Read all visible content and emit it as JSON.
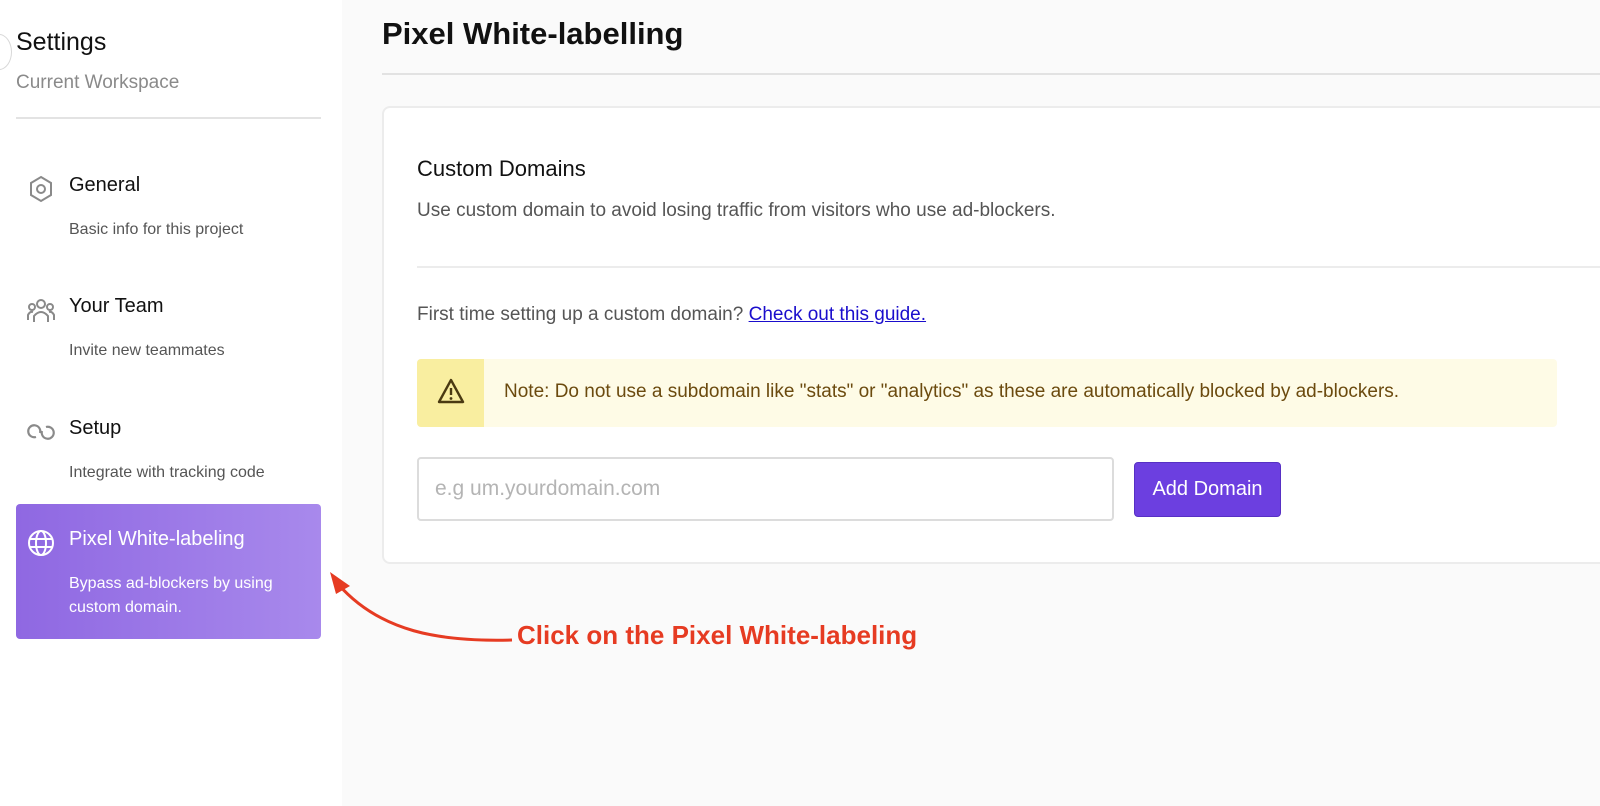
{
  "sidebar": {
    "title": "Settings",
    "subtitle": "Current Workspace",
    "items": [
      {
        "label": "General",
        "desc": "Basic info for this project",
        "icon": "hexagon-settings-icon"
      },
      {
        "label": "Your Team",
        "desc": "Invite new teammates",
        "icon": "team-icon"
      },
      {
        "label": "Setup",
        "desc": "Integrate with tracking code",
        "icon": "link-icon"
      },
      {
        "label": "Pixel White-labeling",
        "desc": "Bypass ad-blockers by using custom domain.",
        "icon": "globe-icon",
        "active": true
      }
    ]
  },
  "main": {
    "title": "Pixel White-labelling",
    "card": {
      "heading": "Custom Domains",
      "description": "Use custom domain to avoid losing traffic from visitors who use ad-blockers.",
      "guide_prefix": "First time setting up a custom domain?",
      "guide_link": "Check out this guide.",
      "note": "Note: Do not use a subdomain like \"stats\" or \"analytics\" as these are automatically blocked by ad-blockers.",
      "note_icon": "warning-icon",
      "input_placeholder": "e.g um.yourdomain.com",
      "input_value": "",
      "button_label": "Add Domain"
    }
  },
  "annotation": {
    "text": "Click on the Pixel White-labeling"
  },
  "colors": {
    "accent": "#6c3fe0",
    "active_item": "#9a78e8",
    "note_bg": "#fefbe6",
    "note_icon_bg": "#f9eea0",
    "annotation": "#e63b22",
    "link": "#1a0dcc"
  }
}
